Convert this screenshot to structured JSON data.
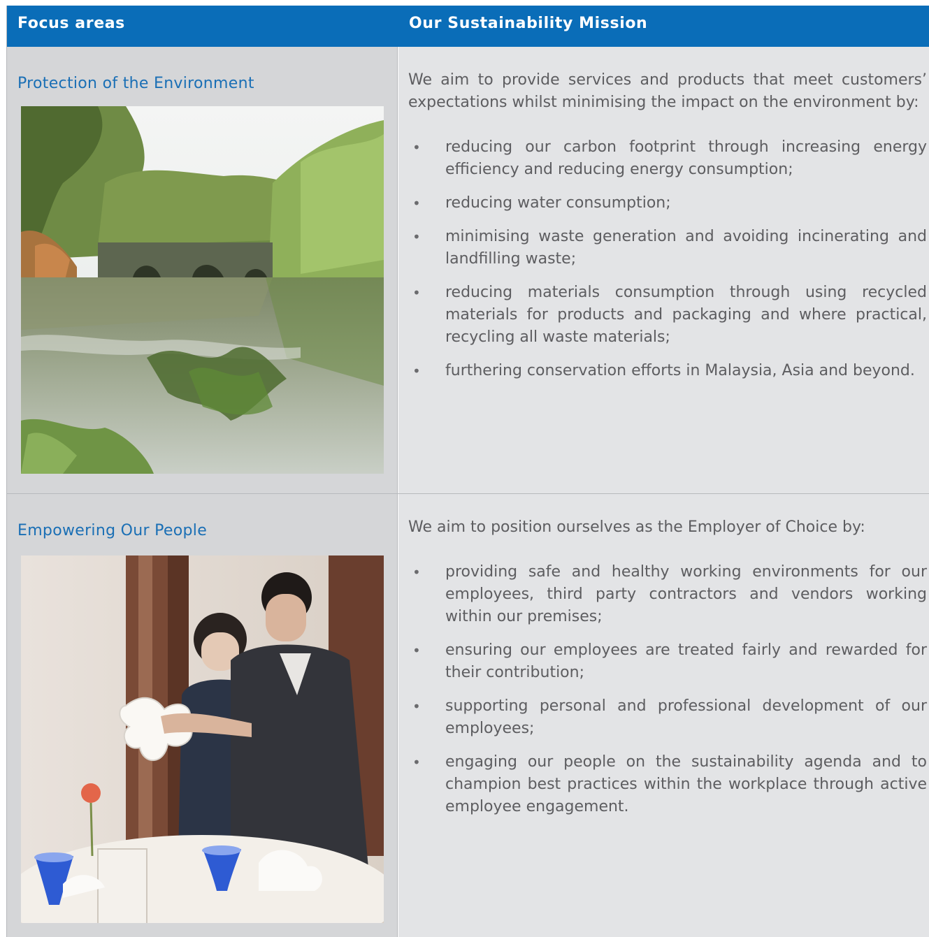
{
  "header": {
    "col1": "Focus areas",
    "col2": "Our Sustainability Mission"
  },
  "rows": [
    {
      "focus": "Protection of the Environment",
      "image": "river-bridge-photo",
      "intro": "We aim to provide services and products that meet customers’ expectations whilst minimising the impact on the environment by:",
      "bullets": [
        "reducing our carbon footprint through increasing energy efficiency and reducing energy consumption;",
        "reducing water consumption;",
        "minimising waste generation and avoiding incinerating and landfilling waste;",
        "reducing materials consumption through using recycled materials for products and packaging and where practical, recycling all waste materials;",
        "furthering conservation efforts in Malaysia, Asia and beyond."
      ]
    },
    {
      "focus": "Empowering Our People",
      "image": "staff-training-photo",
      "intro": "We aim to position ourselves as the Employer of Choice by:",
      "bullets": [
        "providing safe and healthy working environments for our employees, third party contractors and vendors working within our premises;",
        "ensuring our employees are treated fairly and rewarded for their contribution;",
        "supporting personal and professional development of our employees;",
        "engaging our people on the sustainability agenda and to champion best practices within the workplace through active employee engagement."
      ]
    }
  ],
  "bullet_glyph": "•",
  "colors": {
    "header_bg": "#0a6db8",
    "focus_title": "#1a6fb5",
    "left_cell_bg": "#d5d6d8",
    "right_cell_bg": "#e3e4e6"
  }
}
